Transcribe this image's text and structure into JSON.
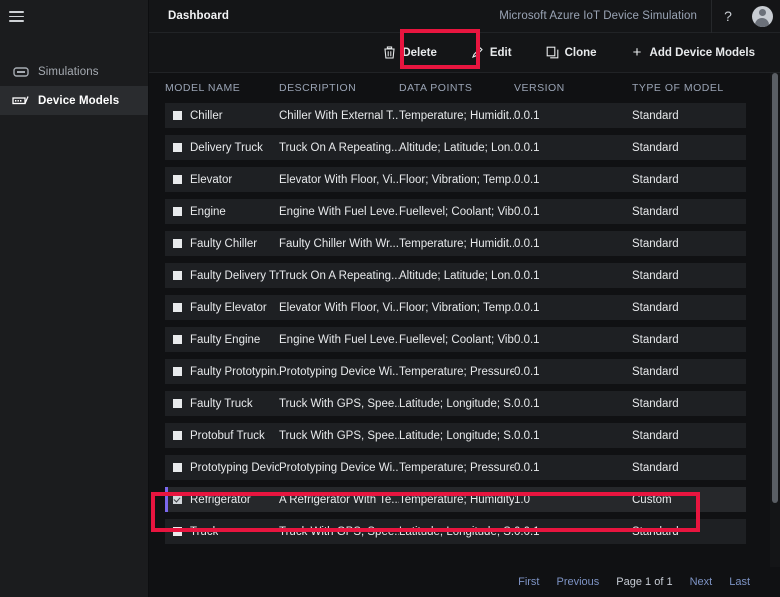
{
  "sidebar": {
    "menu_icon": "hamburger-icon",
    "items": [
      {
        "label": "Simulations",
        "icon": "simulations-icon",
        "active": false
      },
      {
        "label": "Device Models",
        "icon": "device-models-icon",
        "active": true
      }
    ]
  },
  "topbar": {
    "page_title": "Dashboard",
    "brand": "Microsoft Azure IoT Device Simulation",
    "help_label": "?",
    "help_icon": "question-mark-icon",
    "avatar_icon": "user-avatar-icon"
  },
  "toolbar": {
    "buttons": [
      {
        "label": "Delete",
        "icon": "trash-icon"
      },
      {
        "label": "Edit",
        "icon": "pencil-icon"
      },
      {
        "label": "Clone",
        "icon": "copy-icon"
      },
      {
        "label": "Add Device Models",
        "icon": "plus-icon"
      }
    ]
  },
  "table": {
    "columns": [
      "MODEL NAME",
      "DESCRIPTION",
      "DATA POINTS",
      "VERSION",
      "TYPE OF MODEL"
    ],
    "rows": [
      {
        "name": "Chiller",
        "description": "Chiller With External T...",
        "data_points": "Temperature; Humidit...",
        "version": "0.0.1",
        "type": "Standard",
        "selected": false
      },
      {
        "name": "Delivery Truck",
        "description": "Truck On A Repeating...",
        "data_points": "Altitude; Latitude; Lon...",
        "version": "0.0.1",
        "type": "Standard",
        "selected": false
      },
      {
        "name": "Elevator",
        "description": "Elevator With Floor, Vi...",
        "data_points": "Floor; Vibration; Temp...",
        "version": "0.0.1",
        "type": "Standard",
        "selected": false
      },
      {
        "name": "Engine",
        "description": "Engine With Fuel Leve...",
        "data_points": "Fuellevel; Coolant; Vib...",
        "version": "0.0.1",
        "type": "Standard",
        "selected": false
      },
      {
        "name": "Faulty Chiller",
        "description": "Faulty Chiller With Wr...",
        "data_points": "Temperature; Humidit...",
        "version": "0.0.1",
        "type": "Standard",
        "selected": false
      },
      {
        "name": "Faulty Delivery Tr...",
        "description": "Truck On A Repeating...",
        "data_points": "Altitude; Latitude; Lon...",
        "version": "0.0.1",
        "type": "Standard",
        "selected": false
      },
      {
        "name": "Faulty Elevator",
        "description": "Elevator With Floor, Vi...",
        "data_points": "Floor; Vibration; Temp...",
        "version": "0.0.1",
        "type": "Standard",
        "selected": false
      },
      {
        "name": "Faulty Engine",
        "description": "Engine With Fuel Leve...",
        "data_points": "Fuellevel; Coolant; Vib...",
        "version": "0.0.1",
        "type": "Standard",
        "selected": false
      },
      {
        "name": "Faulty Prototypin...",
        "description": "Prototyping Device Wi...",
        "data_points": "Temperature; Pressure...",
        "version": "0.0.1",
        "type": "Standard",
        "selected": false
      },
      {
        "name": "Faulty Truck",
        "description": "Truck With GPS, Spee...",
        "data_points": "Latitude; Longitude; S...",
        "version": "0.0.1",
        "type": "Standard",
        "selected": false
      },
      {
        "name": "Protobuf Truck",
        "description": "Truck With GPS, Spee...",
        "data_points": "Latitude; Longitude; S...",
        "version": "0.0.1",
        "type": "Standard",
        "selected": false
      },
      {
        "name": "Prototyping Device",
        "description": "Prototyping Device Wi...",
        "data_points": "Temperature; Pressure...",
        "version": "0.0.1",
        "type": "Standard",
        "selected": false
      },
      {
        "name": "Refrigerator",
        "description": "A Refrigerator With Te...",
        "data_points": "Temperature; Humidity",
        "version": "1.0",
        "type": "Custom",
        "selected": true
      },
      {
        "name": "Truck",
        "description": "Truck With GPS, Spee...",
        "data_points": "Latitude; Longitude; S...",
        "version": "0.0.1",
        "type": "Standard",
        "selected": false
      }
    ]
  },
  "pagination": {
    "first": "First",
    "previous": "Previous",
    "page_status": "Page 1 of 1",
    "next": "Next",
    "last": "Last"
  },
  "annotations": {
    "color": "#e8153f",
    "highlighted": [
      "Delete button",
      "Refrigerator row"
    ]
  },
  "colors": {
    "accent_selected_row": "#7b68ee",
    "link": "#7d93c4",
    "row_bg": "#1e2023",
    "panel_bg": "#141517"
  }
}
